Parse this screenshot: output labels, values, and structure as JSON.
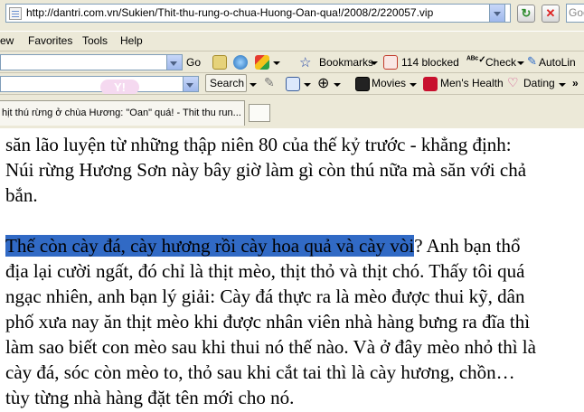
{
  "address_bar": {
    "url": "http://dantri.com.vn/Sukien/Thit-thu-rung-o-chua-Huong-Oan-qua!/2008/2/220057.vip",
    "search_placeholder": "Goo"
  },
  "menu": {
    "items": [
      "ew",
      "Favorites",
      "Tools",
      "Help"
    ]
  },
  "toolbar": {
    "go_label": "Go",
    "bookmarks_label": "Bookmarks",
    "blocked_label": "114 blocked",
    "check_label": "Check",
    "autolink_label": "AutoLin"
  },
  "yahoo_toolbar": {
    "logo_text": "Y!",
    "search_label": "Search",
    "movies_label": "Movies",
    "menshealth_label": "Men's Health",
    "dating_label": "Dating"
  },
  "tabs": [
    {
      "title": "hịt thú rừng ở chùa Hương: \"Oan\" quá! - Thit thu run..."
    }
  ],
  "article": {
    "lines": [
      "săn lão luyện từ những thập niên 80 của thế kỷ trước - khẳng định:",
      "Núi rừng Hương Sơn này bây giờ làm gì còn thú nữa mà săn với chả",
      "bắn.",
      "",
      "",
      "địa lại cười ngất, đó chỉ là thịt mèo, thịt thỏ và thịt chó. Thấy tôi quá",
      "ngạc nhiên, anh bạn lý giải: Cày đá thực ra là mèo được thui kỹ, dân",
      "phố xưa nay ăn thịt mèo khi được nhân viên nhà hàng bưng ra đĩa thì",
      "làm sao biết con mèo sau khi thui nó thế nào. Và ở đây mèo nhỏ thì là",
      "cày đá, sóc còn mèo to, thỏ sau khi cắt tai thì là cày hương, chồn…",
      "tùy từng nhà hàng đặt tên mới cho nó."
    ],
    "highlighted": "Thế còn cày đá, cày hương rồi cày hoa quả và cày vòi",
    "after_highlight": "? Anh bạn thổ"
  },
  "colors": {
    "highlight": "#316ac5",
    "chrome": "#ece9d8"
  }
}
